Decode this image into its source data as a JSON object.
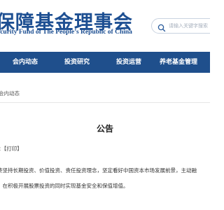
{
  "header": {
    "logo_cn": "保障基金理事会",
    "logo_en": "ecurity Fund of The People’s Republic of China"
  },
  "search": {
    "placeholder": "请输入关键字搜索"
  },
  "nav": {
    "items": [
      {
        "label": "会内动态"
      },
      {
        "label": "投资研究"
      },
      {
        "label": "投资运营"
      },
      {
        "label": "养老基金管理"
      }
    ]
  },
  "breadcrumb": {
    "text": "会内动态"
  },
  "article": {
    "title": "公告",
    "meta_prefix": "：",
    "print_label": "【打印】",
    "paragraphs": [
      "终坚持长期投资、价值投资、责任投资理念，坚定看好中国资本市场发展前景，主动融",
      "。在积极开展股票投资的同时实现基金安全和保值增值。"
    ]
  },
  "colors": {
    "brand": "#1d4f92",
    "nav_bg": "#1f4f8c"
  }
}
